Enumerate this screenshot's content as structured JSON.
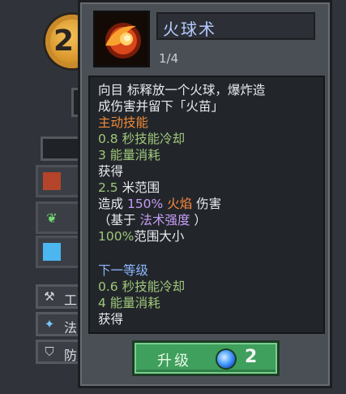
{
  "background": {
    "level_badge_digit": "2",
    "menu_items": [
      {
        "icon": "hammer-icon",
        "label": "工"
      },
      {
        "icon": "wand-icon",
        "label": "法"
      },
      {
        "icon": "shield-icon",
        "label": "防"
      }
    ]
  },
  "tooltip": {
    "skill_name": "火球术",
    "level": "1/4",
    "description_lines": [
      "向目 标释放一个火球，爆炸造",
      "成伤害并留下「火苗」"
    ],
    "active_label": "主动技能",
    "stats": {
      "cooldown": "0.8 秒技能冷却",
      "energy": "3 能量消耗"
    },
    "gain_label": "获得",
    "range": {
      "value": "2.5",
      "unit": "米范围"
    },
    "damage": {
      "prefix": "造成",
      "percent": "150%",
      "element": "火焰",
      "suffix": "伤害"
    },
    "based_on": {
      "open": "（基于",
      "stat": "法术强度",
      "close": "）"
    },
    "size": {
      "value": "100%",
      "label": "范围大小"
    },
    "next_level_label": "下一等级",
    "next_stats": {
      "cooldown": "0.6 秒技能冷却",
      "energy": "4 能量消耗",
      "gain_partial": "获得"
    },
    "upgrade_button": {
      "label": "升级",
      "cost": "2",
      "currency_icon": "blue-gem-icon"
    }
  }
}
